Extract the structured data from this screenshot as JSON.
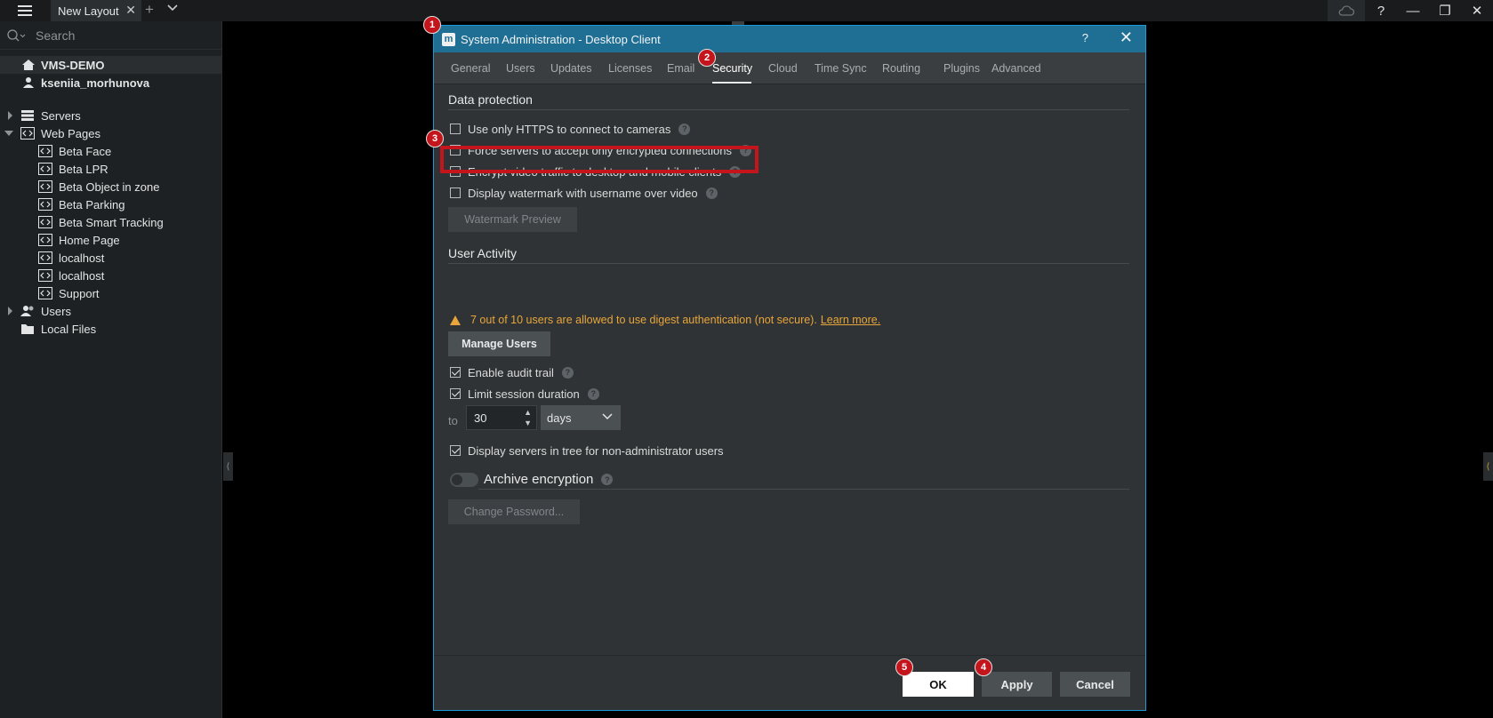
{
  "topbar": {
    "tab_label": "New Layout",
    "tab_close": "✕",
    "add_tab": "+",
    "window": {
      "help": "?",
      "minimize": "—",
      "restore": "❐",
      "close": "✕"
    }
  },
  "sidebar": {
    "search_placeholder": "Search",
    "system_name": "VMS-DEMO",
    "user_name": "kseniia_morhunova",
    "servers": "Servers",
    "web_pages": "Web Pages",
    "web_items": [
      "Beta Face",
      "Beta LPR",
      "Beta Object in zone",
      "Beta Parking",
      "Beta Smart Tracking",
      "Home Page",
      "localhost",
      "localhost",
      "Support"
    ],
    "users": "Users",
    "local_files": "Local Files"
  },
  "dialog": {
    "logo": "m",
    "title": "System Administration - Desktop Client",
    "help": "?",
    "close": "✕",
    "tabs": [
      "General",
      "Users",
      "Updates",
      "Licenses",
      "Email",
      "Security",
      "Cloud",
      "Time Sync",
      "Routing",
      "Plugins",
      "Advanced"
    ],
    "active_tab": "Security",
    "data_protection": {
      "heading": "Data protection",
      "https_only": "Use only HTTPS to connect to cameras",
      "force_encrypted": "Force servers to accept only encrypted connections",
      "encrypt_video": "Encrypt video traffic to desktop and mobile clients",
      "watermark": "Display watermark with username over video",
      "watermark_preview": "Watermark Preview"
    },
    "user_activity": {
      "heading": "User Activity",
      "warning": "7 out of 10 users are allowed to use digest authentication (not secure).",
      "learn_more": "Learn more.",
      "manage_users": "Manage Users",
      "audit_trail": "Enable audit trail",
      "limit_session": "Limit session duration",
      "to_label": "to",
      "duration_value": "30",
      "duration_unit": "days",
      "display_servers": "Display servers in tree for non-administrator users"
    },
    "archive": {
      "heading": "Archive encryption",
      "change_password": "Change Password..."
    },
    "footer": {
      "ok": "OK",
      "apply": "Apply",
      "cancel": "Cancel"
    }
  },
  "annotations": [
    "1",
    "2",
    "3",
    "4",
    "5"
  ],
  "colors": {
    "accent_titlebar": "#1f6f95",
    "warning": "#e8a63a",
    "annotation_red": "#c4151c"
  }
}
